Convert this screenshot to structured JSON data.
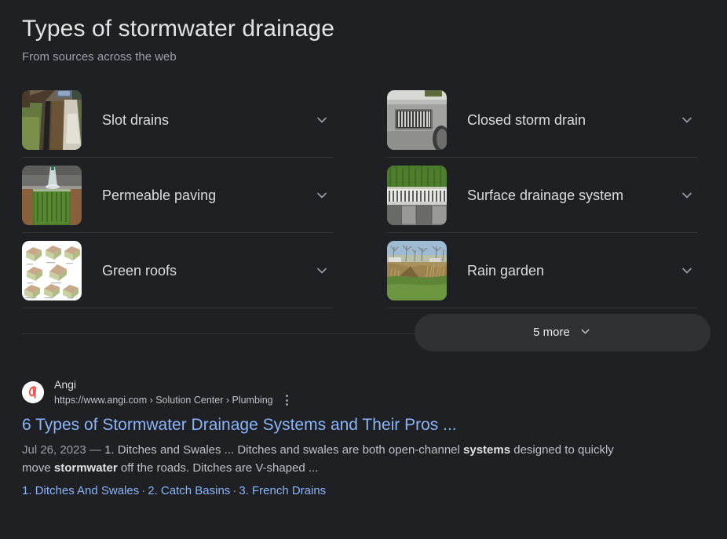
{
  "knowledge_panel": {
    "title": "Types of stormwater drainage",
    "subtitle": "From sources across the web",
    "columns": {
      "left": [
        {
          "label": "Slot drains",
          "thumb": "slot-drain-trench-photo",
          "expand_icon": "chevron-down-icon"
        },
        {
          "label": "Permeable paving",
          "thumb": "permeable-paving-cross-section-photo",
          "expand_icon": "chevron-down-icon"
        },
        {
          "label": "Green roofs",
          "thumb": "green-roof-house-diagrams-illustration",
          "expand_icon": "chevron-down-icon"
        }
      ],
      "right": [
        {
          "label": "Closed storm drain",
          "thumb": "curb-storm-drain-grate-photo",
          "expand_icon": "chevron-down-icon"
        },
        {
          "label": "Surface drainage system",
          "thumb": "slotted-channel-drain-grass-photo",
          "expand_icon": "chevron-down-icon"
        },
        {
          "label": "Rain garden",
          "thumb": "rain-garden-landscape-photo",
          "expand_icon": "chevron-down-icon"
        }
      ]
    },
    "more_button": {
      "label": "5 more",
      "icon": "chevron-down-icon"
    }
  },
  "result": {
    "site_name": "Angi",
    "favicon": "angi-logo-icon",
    "url": "https://www.angi.com › Solution Center › Plumbing",
    "menu_icon": "three-dot-menu-icon",
    "title": "6 Types of Stormwater Drainage Systems and Their Pros ...",
    "snippet": {
      "date": "Jul 26, 2023",
      "dash": "—",
      "part1": "1. Ditches and Swales ... Ditches and swales are both open-channel ",
      "bold1": "systems",
      "part2": " designed to quickly move ",
      "bold2": "stormwater",
      "part3": " off the roads. Ditches are V-shaped ..."
    },
    "sitelinks": [
      {
        "label": "1. Ditches And Swales"
      },
      {
        "label": "2. Catch Basins"
      },
      {
        "label": "3. French Drains"
      }
    ],
    "sitelink_separator": "·"
  },
  "colors": {
    "background": "#1f2023",
    "link": "#8ab4f8",
    "text_primary": "#dadce0",
    "text_secondary": "#9aa0a6",
    "divider": "#34353a",
    "pill": "#303134",
    "angi_red": "#ff4a3d"
  }
}
